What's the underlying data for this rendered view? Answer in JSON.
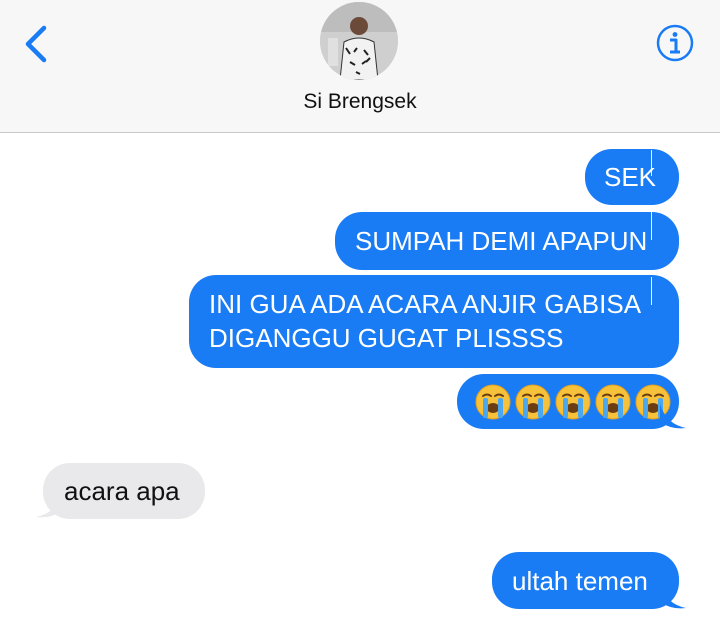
{
  "header": {
    "back_icon": "chevron-left-icon",
    "info_icon": "info-icon",
    "contact_name": "Si Brengsek",
    "accent": "#1a7cf5"
  },
  "messages": [
    {
      "direction": "outgoing",
      "text": "SEK"
    },
    {
      "direction": "outgoing",
      "text": "SUMPAH DEMI APAPUN"
    },
    {
      "direction": "outgoing",
      "lines": [
        "INI GUA ADA ACARA ANJIR GABISA",
        "DIGANGGU GUGAT PLISSSS"
      ]
    },
    {
      "direction": "outgoing",
      "text": "😭😭😭😭😭"
    },
    {
      "direction": "incoming",
      "text": "acara apa"
    },
    {
      "direction": "outgoing",
      "text": "ultah temen"
    }
  ],
  "colors": {
    "outgoing_bubble": "#1a7cf5",
    "incoming_bubble": "#e9e9eb",
    "header_bg": "#f7f7f7"
  }
}
